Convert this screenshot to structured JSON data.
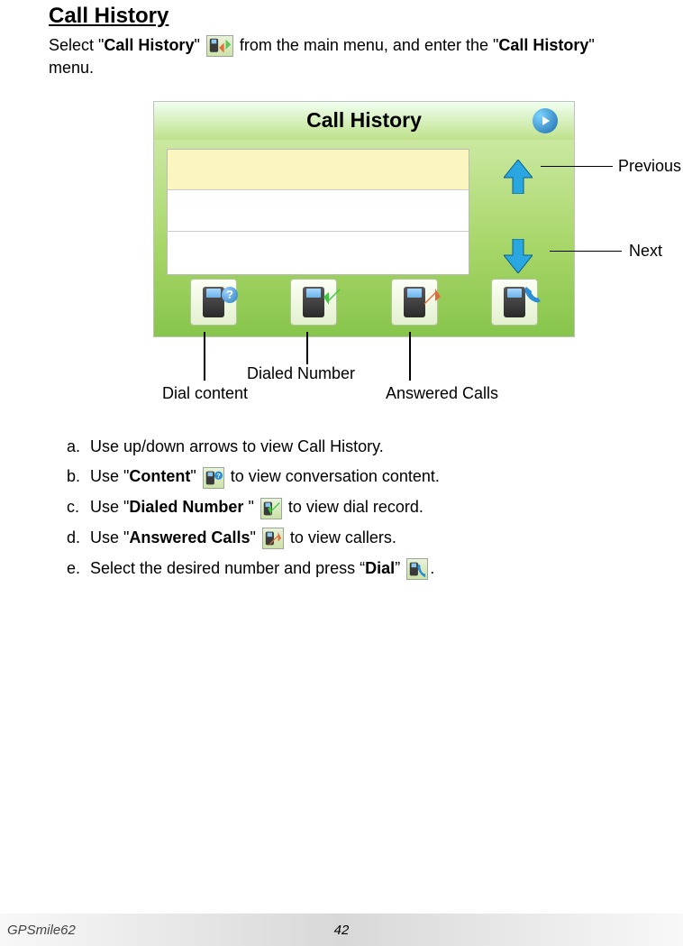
{
  "heading": "Call History",
  "intro": {
    "pre": "Select \"",
    "bold1": "Call History",
    "mid1": "\" ",
    "mid2": " from the main menu, and enter the \"",
    "bold2": "Call History",
    "post": "\" menu."
  },
  "screenshot": {
    "title": "Call History"
  },
  "callouts": {
    "previous": "Previous",
    "next": "Next",
    "dial_content": "Dial content",
    "dialed_number": "Dialed Number",
    "answered_calls": "Answered Calls"
  },
  "instructions": [
    {
      "letter": "a.",
      "text_pre": " Use up/down arrows to view Call History."
    },
    {
      "letter": "b.",
      "text_pre": " Use \"",
      "bold": "Content",
      "text_mid": "\" ",
      "icon": "content-icon",
      "text_post": " to view conversation content."
    },
    {
      "letter": "c.",
      "text_pre": " Use \"",
      "bold": "Dialed Number ",
      "text_mid": "\" ",
      "icon": "dialed-number-icon",
      "text_post": " to view dial record."
    },
    {
      "letter": "d.",
      "text_pre": " Use \"",
      "bold": "Answered Calls",
      "text_mid": "\" ",
      "icon": "answered-calls-icon",
      "text_post": " to view callers."
    },
    {
      "letter": "e.",
      "text_pre": " Select the desired number and press “",
      "bold": "Dial",
      "text_mid": "” ",
      "icon": "dial-icon",
      "text_post": "."
    }
  ],
  "footer": {
    "model": "GPSmile62",
    "page": "42"
  }
}
